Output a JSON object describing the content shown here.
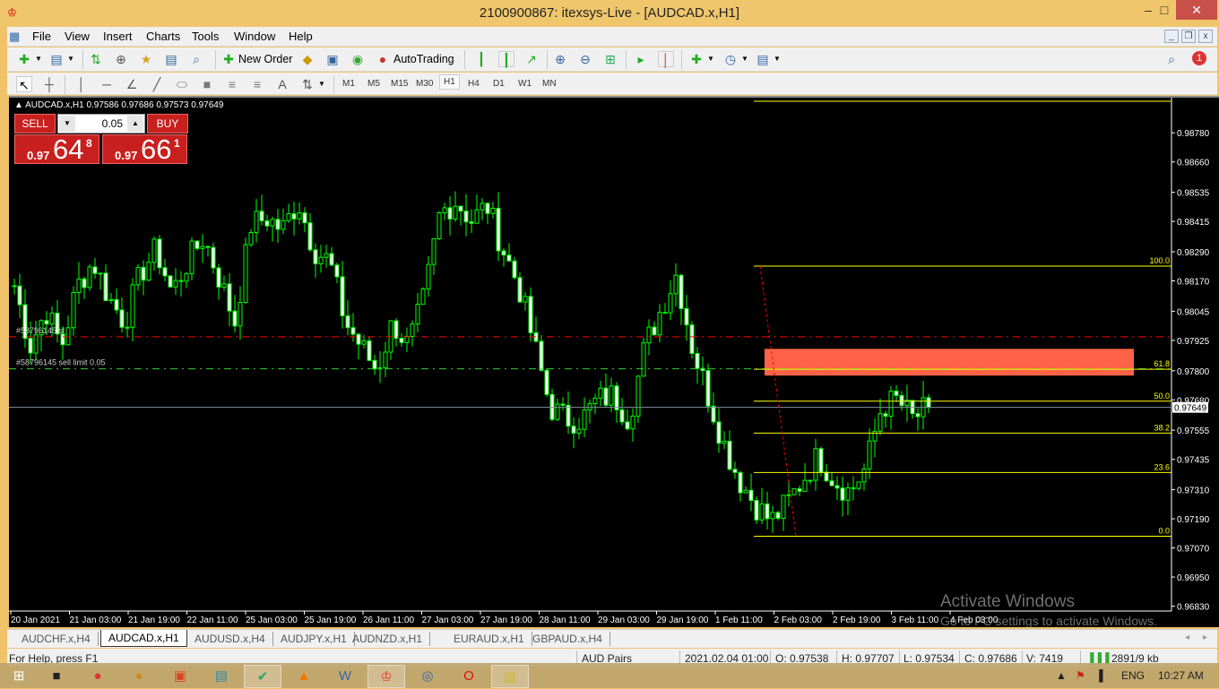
{
  "window": {
    "title": "2100900867: itexsys-Live - [AUDCAD.x,H1]",
    "minimize": "‒",
    "maximize": "□",
    "close": "✕"
  },
  "menu": [
    "File",
    "View",
    "Insert",
    "Charts",
    "Tools",
    "Window",
    "Help"
  ],
  "mdi": {
    "minimize": "_",
    "restore": "❐",
    "close": "x"
  },
  "toolbar": {
    "new_order": "New Order",
    "auto_trading": "AutoTrading",
    "notification_count": "1"
  },
  "timeframes": [
    "M1",
    "M5",
    "M15",
    "M30",
    "H1",
    "H4",
    "D1",
    "W1",
    "MN"
  ],
  "active_timeframe": "H1",
  "chart": {
    "header": "AUDCAD.x,H1  0.97586 0.97686 0.97573 0.97649",
    "one_click": {
      "sell_label": "SELL",
      "buy_label": "BUY",
      "lot": "0.05",
      "sell_prefix": "0.97",
      "sell_big": "64",
      "sell_sup": "8",
      "buy_prefix": "0.97",
      "buy_big": "66",
      "buy_sup": "1"
    },
    "order_sl_label": "#58796145 sl",
    "order_limit_label": "#58796145 sell limit 0.05",
    "current_price": "0.97649"
  },
  "chart_data": {
    "type": "candlestick",
    "symbol": "AUDCAD.x",
    "timeframe": "H1",
    "y_ticks": [
      "0.98780",
      "0.98660",
      "0.98535",
      "0.98415",
      "0.98290",
      "0.98170",
      "0.98045",
      "0.97925",
      "0.97800",
      "0.97680",
      "0.97555",
      "0.97435",
      "0.97310",
      "0.97190",
      "0.97070",
      "0.96950",
      "0.96830"
    ],
    "ylim": [
      0.9681,
      0.9891
    ],
    "x_ticks": [
      "20 Jan 2021",
      "21 Jan 03:00",
      "21 Jan 19:00",
      "22 Jan 11:00",
      "25 Jan 03:00",
      "25 Jan 19:00",
      "26 Jan 11:00",
      "27 Jan 03:00",
      "27 Jan 19:00",
      "28 Jan 11:00",
      "29 Jan 03:00",
      "29 Jan 19:00",
      "1 Feb 11:00",
      "2 Feb 03:00",
      "2 Feb 19:00",
      "3 Feb 11:00",
      "4 Feb 03:00"
    ],
    "close_waypoints": [
      0.9815,
      0.979,
      0.9805,
      0.979,
      0.9815,
      0.9825,
      0.981,
      0.98,
      0.982,
      0.983,
      0.9812,
      0.9825,
      0.9835,
      0.9818,
      0.98,
      0.984,
      0.9843,
      0.9838,
      0.985,
      0.983,
      0.9825,
      0.98,
      0.979,
      0.978,
      0.98,
      0.979,
      0.981,
      0.9845,
      0.985,
      0.9842,
      0.9848,
      0.983,
      0.9815,
      0.979,
      0.9765,
      0.976,
      0.976,
      0.9768,
      0.977,
      0.976,
      0.979,
      0.9805,
      0.982,
      0.979,
      0.977,
      0.975,
      0.9735,
      0.9725,
      0.9718,
      0.9725,
      0.9735,
      0.9745,
      0.9735,
      0.973,
      0.974,
      0.9765,
      0.9768,
      0.976,
      0.9765
    ],
    "last_close": 0.97649,
    "bull_color": "#00ff00",
    "bear_color": "#00ff00",
    "bear_fill": "#ffffff",
    "fibonacci": {
      "high": 0.98231,
      "low": 0.97118,
      "levels": [
        {
          "label": "100.0",
          "ratio": 1.0
        },
        {
          "label": "61.8",
          "ratio": 0.618
        },
        {
          "label": "50.0",
          "ratio": 0.5
        },
        {
          "label": "38.2",
          "ratio": 0.382
        },
        {
          "label": "23.6",
          "ratio": 0.236
        },
        {
          "label": "0.0",
          "ratio": 0.0
        }
      ],
      "color": "#ffff00"
    },
    "zone": {
      "top": 0.9789,
      "bottom": 0.9778,
      "color": "#ff6347"
    },
    "sl_line": {
      "price": 0.9794,
      "color": "#ff0000"
    },
    "sell_limit_line": {
      "price": 0.97808,
      "color": "#32cd32"
    },
    "bid_line": {
      "price": 0.97649,
      "color": "#8090a0"
    }
  },
  "tabs": [
    "AUDCHF.x,H4",
    "AUDCAD.x,H1",
    "AUDUSD.x,H4",
    "AUDJPY.x,H1",
    "AUDNZD.x,H1",
    "EURAUD.x,H1",
    "GBPAUD.x,H4"
  ],
  "active_tab": "AUDCAD.x,H1",
  "status": {
    "help": "For Help, press F1",
    "profile": "AUD Pairs",
    "datetime": "2021.02.04 01:00",
    "open": "O: 0.97538",
    "high": "H: 0.97707",
    "low": "L: 0.97534",
    "close": "C: 0.97686",
    "volume": "V: 7419",
    "traffic": "2891/9 kb"
  },
  "taskbar": {
    "language": "ENG",
    "time": "10:27 AM"
  },
  "watermark": {
    "line1": "Activate Windows",
    "line2": "Go to PC settings to activate Windows."
  }
}
